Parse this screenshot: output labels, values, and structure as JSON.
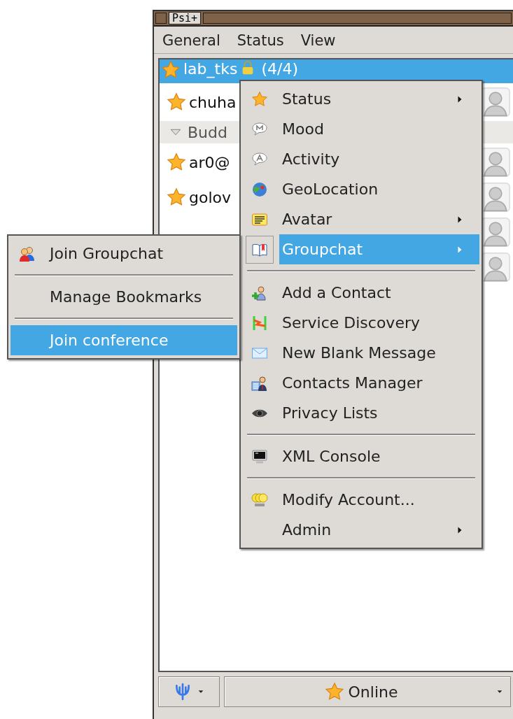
{
  "window": {
    "title": "Psi+"
  },
  "menubar": [
    {
      "label": "General"
    },
    {
      "label": "Status"
    },
    {
      "label": "View"
    }
  ],
  "roster": {
    "rows": [
      {
        "kind": "account",
        "name": "lab_tks",
        "count": "(4/4)",
        "selected": true
      },
      {
        "kind": "contact",
        "name": "chuha",
        "selected": false
      },
      {
        "kind": "group",
        "name": "Budd",
        "expanded": true,
        "selected": false
      },
      {
        "kind": "contact",
        "name": "ar0@",
        "selected": false
      },
      {
        "kind": "contact",
        "name": "golov",
        "selected": false
      },
      {
        "kind": "contact",
        "selected": false
      },
      {
        "kind": "contact",
        "selected": false
      }
    ]
  },
  "context_menu": {
    "items": [
      {
        "kind": "item",
        "label": "Status",
        "has_submenu": true,
        "selected": false
      },
      {
        "kind": "item",
        "label": "Mood",
        "has_submenu": false,
        "selected": false
      },
      {
        "kind": "item",
        "label": "Activity",
        "has_submenu": false,
        "selected": false
      },
      {
        "kind": "item",
        "label": "GeoLocation",
        "has_submenu": false,
        "selected": false
      },
      {
        "kind": "item",
        "label": "Avatar",
        "has_submenu": true,
        "selected": false
      },
      {
        "kind": "item",
        "label": "Groupchat",
        "has_submenu": true,
        "selected": true
      },
      {
        "kind": "separator"
      },
      {
        "kind": "item",
        "label": "Add a Contact",
        "has_submenu": false,
        "selected": false
      },
      {
        "kind": "item",
        "label": "Service Discovery",
        "has_submenu": false,
        "selected": false
      },
      {
        "kind": "item",
        "label": "New Blank Message",
        "has_submenu": false,
        "selected": false
      },
      {
        "kind": "item",
        "label": "Contacts Manager",
        "has_submenu": false,
        "selected": false
      },
      {
        "kind": "item",
        "label": "Privacy Lists",
        "has_submenu": false,
        "selected": false
      },
      {
        "kind": "separator"
      },
      {
        "kind": "item",
        "label": "XML Console",
        "has_submenu": false,
        "selected": false
      },
      {
        "kind": "separator"
      },
      {
        "kind": "item",
        "label": "Modify Account...",
        "has_submenu": false,
        "selected": false
      },
      {
        "kind": "item",
        "label": "Admin",
        "has_submenu": true,
        "selected": false
      }
    ]
  },
  "groupchat_submenu": {
    "items": [
      {
        "kind": "item",
        "label": "Join Groupchat",
        "selected": false
      },
      {
        "kind": "separator"
      },
      {
        "kind": "item",
        "label": "Manage Bookmarks",
        "selected": false
      },
      {
        "kind": "separator"
      },
      {
        "kind": "item",
        "label": "Join conference",
        "selected": true
      }
    ]
  },
  "status_bar": {
    "status": "Online"
  }
}
